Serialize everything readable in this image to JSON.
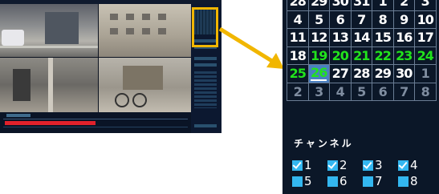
{
  "calendar": {
    "rows": [
      [
        {
          "d": "28"
        },
        {
          "d": "29"
        },
        {
          "d": "30"
        },
        {
          "d": "31"
        },
        {
          "d": "1"
        },
        {
          "d": "2"
        },
        {
          "d": "3"
        }
      ],
      [
        {
          "d": "4"
        },
        {
          "d": "5"
        },
        {
          "d": "6"
        },
        {
          "d": "7"
        },
        {
          "d": "8"
        },
        {
          "d": "9"
        },
        {
          "d": "10"
        }
      ],
      [
        {
          "d": "11"
        },
        {
          "d": "12"
        },
        {
          "d": "13"
        },
        {
          "d": "14"
        },
        {
          "d": "15"
        },
        {
          "d": "16"
        },
        {
          "d": "17"
        }
      ],
      [
        {
          "d": "18"
        },
        {
          "d": "19",
          "rec": true
        },
        {
          "d": "20",
          "rec": true
        },
        {
          "d": "21",
          "rec": true
        },
        {
          "d": "22",
          "rec": true
        },
        {
          "d": "23",
          "rec": true
        },
        {
          "d": "24",
          "rec": true
        }
      ],
      [
        {
          "d": "25",
          "rec": true
        },
        {
          "d": "26",
          "rec": true,
          "sel": true
        },
        {
          "d": "27"
        },
        {
          "d": "28"
        },
        {
          "d": "29"
        },
        {
          "d": "30"
        },
        {
          "d": "1",
          "dim": true
        }
      ],
      [
        {
          "d": "2",
          "dim": true
        },
        {
          "d": "3",
          "dim": true
        },
        {
          "d": "4",
          "dim": true
        },
        {
          "d": "5",
          "dim": true
        },
        {
          "d": "6",
          "dim": true
        },
        {
          "d": "7",
          "dim": true
        },
        {
          "d": "8",
          "dim": true
        }
      ]
    ]
  },
  "channels": {
    "title": "チャンネル",
    "items": [
      {
        "label": "1",
        "checked": true
      },
      {
        "label": "2",
        "checked": true
      },
      {
        "label": "3",
        "checked": true
      },
      {
        "label": "4",
        "checked": true
      },
      {
        "label": "5",
        "checked": false
      },
      {
        "label": "6",
        "checked": false
      },
      {
        "label": "7",
        "checked": false
      },
      {
        "label": "8",
        "checked": false
      }
    ]
  },
  "colors": {
    "highlight": "#f1b600",
    "recorded_day": "#22e31c",
    "selected_day": "#4a7fc0",
    "checkbox": "#33b7f0",
    "timeline_bar": "#e0212b"
  },
  "timeline": {
    "recorded_fraction": 0.47
  }
}
